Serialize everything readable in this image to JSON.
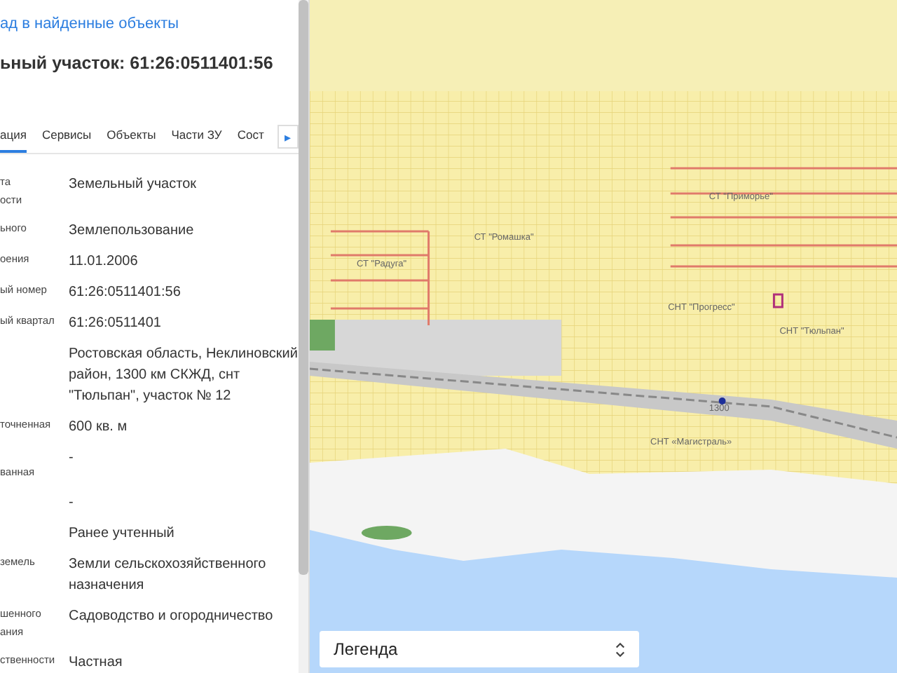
{
  "panel": {
    "back_link": "ад в найденные объекты",
    "title": "ьный участок: 61:26:0511401:56",
    "tabs": [
      {
        "label": "ация",
        "selected": true
      },
      {
        "label": "Сервисы",
        "selected": false
      },
      {
        "label": "Объекты",
        "selected": false
      },
      {
        "label": "Части ЗУ",
        "selected": false
      },
      {
        "label": "Сост",
        "selected": false
      }
    ],
    "tab_scroll": "▸",
    "rows": [
      {
        "label": "та\nости",
        "value": "Земельный участок"
      },
      {
        "label": "ьного",
        "value": "Землепользование"
      },
      {
        "label": "оения",
        "value": "11.01.2006"
      },
      {
        "label": "ый номер",
        "value": "61:26:0511401:56"
      },
      {
        "label": "ый квартал",
        "value": "61:26:0511401"
      },
      {
        "label": "",
        "value": "Ростовская область, Неклиновский район, 1300 км СКЖД, снт \"Тюльпан\", участок № 12"
      },
      {
        "label": "точненная",
        "value": "600 кв. м"
      },
      {
        "label": "\nванная",
        "value": "-"
      },
      {
        "label": "",
        "value": "-"
      },
      {
        "label": "",
        "value": "Ранее учтенный"
      },
      {
        "label": "земель",
        "value": "Земли сельскохозяйственного назначения"
      },
      {
        "label": "шенного\nания",
        "value": "Садоводство и огородничество"
      },
      {
        "label": "ственности",
        "value": "Частная"
      }
    ]
  },
  "map": {
    "labels": [
      {
        "text": "СТ \"Приморье\""
      },
      {
        "text": "СТ \"Ромашка\""
      },
      {
        "text": "СТ \"Радуга\""
      },
      {
        "text": "СНТ \"Прогресс\""
      },
      {
        "text": "СНТ \"Тюльпан\""
      },
      {
        "text": "1300"
      },
      {
        "text": "СНТ «Магистраль»"
      }
    ],
    "legend": {
      "label": "Легенда"
    }
  }
}
